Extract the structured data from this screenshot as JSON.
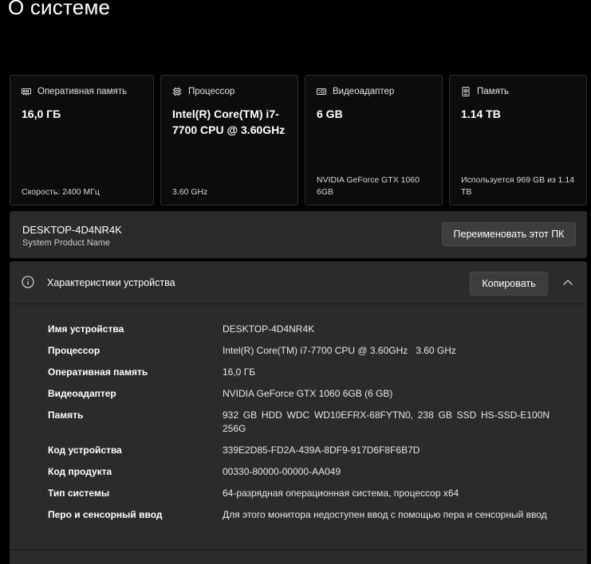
{
  "page": {
    "title": "О системе"
  },
  "cards": [
    {
      "icon": "memory-icon",
      "label": "Оперативная память",
      "value": "16,0 ГБ",
      "foot": "Скорость: 2400 МГц"
    },
    {
      "icon": "processor-icon",
      "label": "Процессор",
      "value": "Intel(R) Core(TM) i7-7700 CPU @ 3.60GHz",
      "foot": "3.60 GHz"
    },
    {
      "icon": "gpu-icon",
      "label": "Видеоадаптер",
      "value": "6 GB",
      "foot": "NVIDIA GeForce GTX 1060 6GB"
    },
    {
      "icon": "storage-icon",
      "label": "Память",
      "value": "1.14 TB",
      "foot": "Используется 969 GB из 1.14 TB"
    }
  ],
  "device": {
    "name": "DESKTOP-4D4NR4K",
    "model": "System Product Name",
    "rename_label": "Переименовать этот ПК"
  },
  "specs": {
    "title": "Характеристики устройства",
    "copy_label": "Копировать",
    "rows": [
      {
        "key": "Имя устройства",
        "value": "DESKTOP-4D4NR4K"
      },
      {
        "key": "Процессор",
        "value": "Intel(R) Core(TM) i7-7700 CPU @ 3.60GHz   3.60 GHz"
      },
      {
        "key": "Оперативная память",
        "value": "16,0 ГБ"
      },
      {
        "key": "Видеоадаптер",
        "value": "NVIDIA GeForce GTX 1060 6GB (6 GB)"
      },
      {
        "key": "Память",
        "value": "932 GB HDD WDC WD10EFRX-68FYTN0, 238 GB SSD HS-SSD-E100N 256G"
      },
      {
        "key": "Код устройства",
        "value": "339E2D85-FD2A-439A-8DF9-917D6F8F6B7D"
      },
      {
        "key": "Код продукта",
        "value": "00330-80000-00000-AA049"
      },
      {
        "key": "Тип системы",
        "value": "64-разрядная операционная система, процессор x64"
      },
      {
        "key": "Перо и сенсорный ввод",
        "value": "Для этого монитора недоступен ввод с помощью пера и сенсорный ввод"
      }
    ]
  }
}
